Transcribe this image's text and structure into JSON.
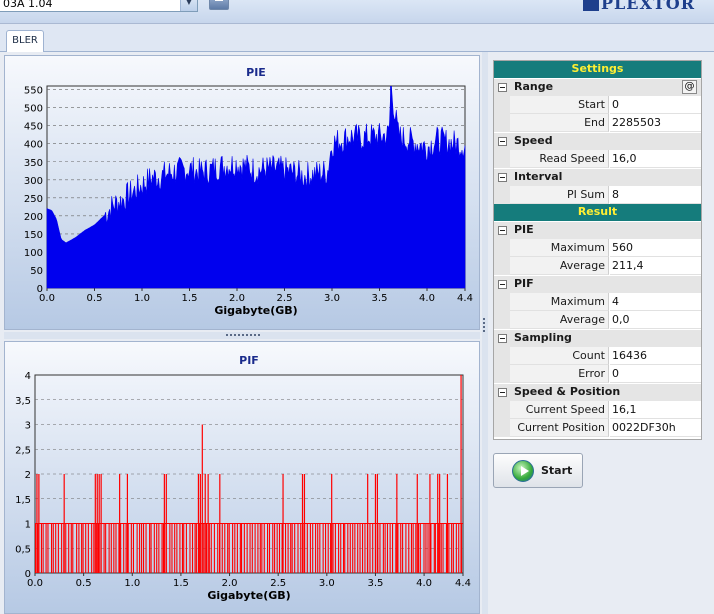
{
  "toolbar": {
    "drive_label": "03A 1.04",
    "brand": "PLEXTOR"
  },
  "tabs": [
    {
      "label": "BLER"
    }
  ],
  "settings": {
    "header": "Settings",
    "range": {
      "label": "Range",
      "button": "@",
      "start_label": "Start",
      "start": "0",
      "end_label": "End",
      "end": "2285503"
    },
    "speed": {
      "label": "Speed",
      "read_speed_label": "Read Speed",
      "read_speed": "16,0"
    },
    "interval": {
      "label": "Interval",
      "pi_sum_label": "PI Sum",
      "pi_sum": "8"
    }
  },
  "result": {
    "header": "Result",
    "pie": {
      "label": "PIE",
      "max_label": "Maximum",
      "max": "560",
      "avg_label": "Average",
      "avg": "211,4"
    },
    "pif": {
      "label": "PIF",
      "max_label": "Maximum",
      "max": "4",
      "avg_label": "Average",
      "avg": "0,0"
    },
    "sampling": {
      "label": "Sampling",
      "count_label": "Count",
      "count": "16436",
      "error_label": "Error",
      "error": "0"
    },
    "speed_position": {
      "label": "Speed & Position",
      "current_speed_label": "Current Speed",
      "current_speed": "16,1",
      "current_position_label": "Current Position",
      "current_position": "0022DF30h"
    }
  },
  "start_button": {
    "label": "Start"
  },
  "chart_data": [
    {
      "type": "area",
      "title": "PIE",
      "xlabel": "Gigabyte(GB)",
      "ylabel": "",
      "xlim": [
        0.0,
        4.4
      ],
      "ylim": [
        0,
        560
      ],
      "xticks": [
        "0.0",
        "0.5",
        "1.0",
        "1.5",
        "2.0",
        "2.5",
        "3.0",
        "3.5",
        "4.0",
        "4.4"
      ],
      "yticks": [
        "0",
        "50",
        "100",
        "150",
        "200",
        "250",
        "300",
        "350",
        "400",
        "450",
        "500",
        "550"
      ],
      "grid": true,
      "color": "#0000ee",
      "x": [
        0.0,
        0.05,
        0.1,
        0.15,
        0.2,
        0.3,
        0.4,
        0.5,
        0.6,
        0.7,
        0.8,
        0.9,
        1.0,
        1.1,
        1.2,
        1.3,
        1.4,
        1.5,
        1.6,
        1.7,
        1.8,
        1.9,
        2.0,
        2.1,
        2.2,
        2.3,
        2.4,
        2.5,
        2.6,
        2.7,
        2.8,
        2.9,
        2.95,
        3.0,
        3.1,
        3.2,
        3.3,
        3.4,
        3.5,
        3.6,
        3.62,
        3.7,
        3.8,
        3.9,
        4.0,
        4.1,
        4.2,
        4.3,
        4.4
      ],
      "y": [
        220,
        215,
        190,
        135,
        125,
        140,
        160,
        175,
        200,
        230,
        245,
        265,
        285,
        305,
        310,
        320,
        325,
        330,
        320,
        325,
        335,
        340,
        345,
        335,
        325,
        330,
        330,
        325,
        320,
        310,
        315,
        320,
        320,
        400,
        410,
        420,
        415,
        420,
        420,
        425,
        560,
        420,
        410,
        400,
        390,
        410,
        405,
        400,
        395
      ]
    },
    {
      "type": "bar",
      "title": "PIF",
      "xlabel": "Gigabyte(GB)",
      "ylabel": "",
      "xlim": [
        0.0,
        4.4
      ],
      "ylim": [
        0,
        4
      ],
      "xticks": [
        "0.0",
        "0.5",
        "1.0",
        "1.5",
        "2.0",
        "2.5",
        "3.0",
        "3.5",
        "4.0",
        "4.4"
      ],
      "yticks": [
        "0",
        "0,5",
        "1",
        "1,5",
        "2",
        "2,5",
        "3",
        "3,5",
        "4"
      ],
      "grid": true,
      "color": "#ff0000",
      "base_level": 1,
      "peaks": [
        {
          "x": 0.02,
          "y": 2
        },
        {
          "x": 0.04,
          "y": 2
        },
        {
          "x": 0.3,
          "y": 2
        },
        {
          "x": 0.62,
          "y": 2
        },
        {
          "x": 0.64,
          "y": 2
        },
        {
          "x": 0.66,
          "y": 2
        },
        {
          "x": 0.68,
          "y": 2
        },
        {
          "x": 0.87,
          "y": 2
        },
        {
          "x": 0.95,
          "y": 2
        },
        {
          "x": 1.33,
          "y": 2
        },
        {
          "x": 1.35,
          "y": 2
        },
        {
          "x": 1.68,
          "y": 2
        },
        {
          "x": 1.7,
          "y": 2
        },
        {
          "x": 1.72,
          "y": 3
        },
        {
          "x": 1.75,
          "y": 2
        },
        {
          "x": 1.78,
          "y": 2
        },
        {
          "x": 1.9,
          "y": 2
        },
        {
          "x": 2.55,
          "y": 2
        },
        {
          "x": 2.75,
          "y": 2
        },
        {
          "x": 2.77,
          "y": 2
        },
        {
          "x": 3.05,
          "y": 2
        },
        {
          "x": 3.42,
          "y": 2
        },
        {
          "x": 3.5,
          "y": 2
        },
        {
          "x": 3.52,
          "y": 2
        },
        {
          "x": 3.72,
          "y": 2
        },
        {
          "x": 3.93,
          "y": 2
        },
        {
          "x": 4.06,
          "y": 2
        },
        {
          "x": 4.14,
          "y": 2
        },
        {
          "x": 4.16,
          "y": 2
        },
        {
          "x": 4.24,
          "y": 2
        },
        {
          "x": 4.38,
          "y": 4
        }
      ]
    }
  ]
}
